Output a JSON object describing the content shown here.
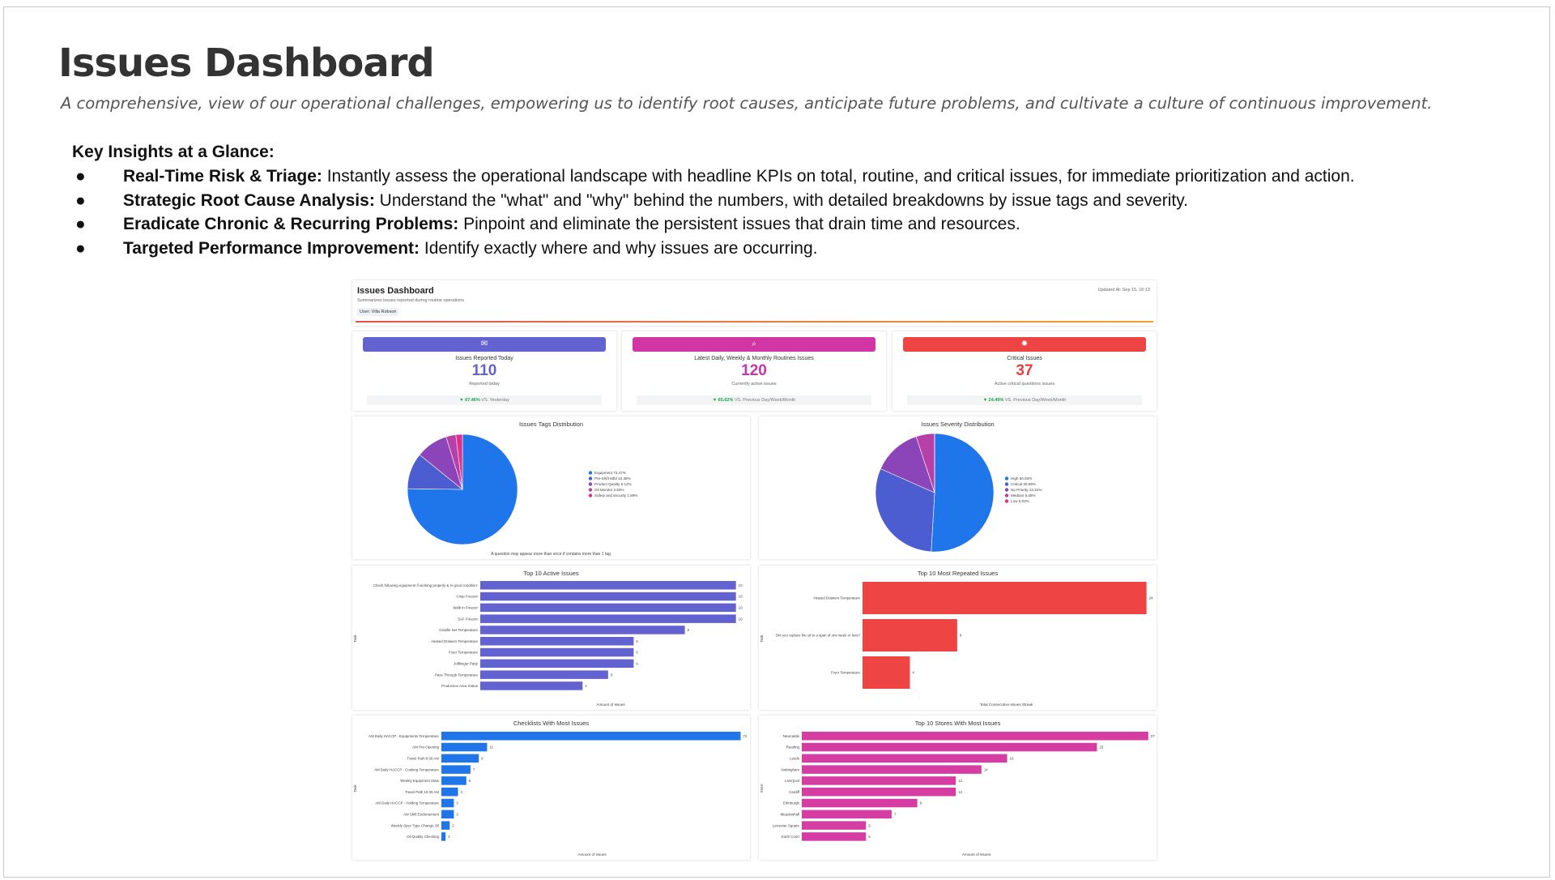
{
  "page": {
    "title": "Issues Dashboard",
    "subtitle": "A comprehensive, view of our operational challenges, empowering us to identify root causes, anticipate future problems, and cultivate a culture of continuous improvement.",
    "insights_heading": "Key Insights at a Glance:",
    "bullet_glyph": "●",
    "bullets": [
      {
        "label": "Real-Time Risk & Triage:",
        "text": "Instantly assess the operational landscape with headline KPIs on total, routine, and critical issues, for immediate prioritization and action."
      },
      {
        "label": "Strategic Root Cause Analysis:",
        "text": "Understand the \"what\" and \"why\" behind the numbers, with detailed breakdowns by issue tags and severity."
      },
      {
        "label": "Eradicate Chronic & Recurring Problems:",
        "text": "Pinpoint and eliminate the persistent issues that drain time and resources."
      },
      {
        "label": "Targeted Performance Improvement:",
        "text": "Identify exactly where and why issues are occurring."
      }
    ]
  },
  "dashboard": {
    "header": {
      "title": "Issues Dashboard",
      "subtitle": "Summarizes issues reported during routine operations",
      "user": "User: Villa Robson",
      "updated": "Updated At: Sep 15, 10:13"
    },
    "kpis": [
      {
        "icon": "chat-bubble-icon",
        "icon_glyph": "✉",
        "label": "Issues Reported Today",
        "value": "110",
        "caption": "Reported today",
        "change": "▼ 67.46%",
        "comparison": "VS. Yesterday",
        "color": "#6362d1",
        "bar_color": "#6362d1"
      },
      {
        "icon": "checklist-search-icon",
        "icon_glyph": "⌕",
        "label": "Latest Daily, Weekly & Monthly Routines Issues",
        "value": "120",
        "caption": "Currently active issues",
        "change": "▼ 65.62%",
        "comparison": "VS. Previous Day/Week/Month",
        "color": "#c536a8",
        "bar_color": "#d235a4"
      },
      {
        "icon": "virus-icon",
        "icon_glyph": "✹",
        "label": "Critical Issues",
        "value": "37",
        "caption": "Active critical questions issues",
        "change": "▼ 24.49%",
        "comparison": "VS. Previous Day/Week/Month",
        "color": "#ec3d3d",
        "bar_color": "#ef4444"
      }
    ]
  },
  "chart_data": [
    {
      "type": "pie",
      "title": "Issues Tags Distribution",
      "footnote": "A question may appear more than once if contains more than 1 tag",
      "slices": [
        {
          "label": "Equipment",
          "value": 73.47,
          "legend": "Equipment 73.47%",
          "color": "#1f75ea"
        },
        {
          "label": "Pre-Shift Mtbl",
          "value": 10.38,
          "legend": "Pre-Shift Mtbl 10.38%",
          "color": "#4c5dd1"
        },
        {
          "label": "Product Quality",
          "value": 9.12,
          "legend": "Product Quality 9.12%",
          "color": "#8c45b8"
        },
        {
          "label": "Oil Monitor",
          "value": 2.83,
          "legend": "Oil Monitor 2.83%",
          "color": "#b63fa8"
        },
        {
          "label": "Safety and security",
          "value": 1.89,
          "legend": "Safety and security 1.89%",
          "color": "#e02e8c"
        }
      ]
    },
    {
      "type": "pie",
      "title": "Issues Severity Distribution",
      "slices": [
        {
          "label": "High",
          "value": 50.93,
          "legend": "High 50.93%",
          "color": "#1f75ea"
        },
        {
          "label": "Critical",
          "value": 30.69,
          "legend": "Critical 30.69%",
          "color": "#4c5dd1"
        },
        {
          "label": "No Priority",
          "value": 13.31,
          "legend": "No Priority 13.31%",
          "color": "#8c45b8"
        },
        {
          "label": "Medium",
          "value": 5.05,
          "legend": "Medium 5.05%",
          "color": "#b63fa8"
        },
        {
          "label": "Low",
          "value": 0.02,
          "legend": "Low 0.02%",
          "color": "#e02e8c"
        }
      ]
    },
    {
      "type": "bar",
      "orientation": "horizontal",
      "title": "Top 10 Active Issues",
      "xlabel": "Amount of issues",
      "ylabel": "Task",
      "color": "#6362d1",
      "categories": [
        "Check following equipment if working properly & in good condition:",
        "Crisp Freezer",
        "Walk in Freezer",
        "SAF Freezer",
        "Griddle Set Temperature",
        "Heated Drawers Temperature",
        "Fryer Temperature",
        "Jollibeger Patty",
        "Pass Through Temperature",
        "Production Area Status"
      ],
      "values": [
        10,
        10,
        10,
        10,
        8,
        6,
        6,
        6,
        5,
        4
      ],
      "xlim": [
        0,
        10.2
      ]
    },
    {
      "type": "bar",
      "orientation": "horizontal",
      "title": "Top 10 Most Repeated Issues",
      "xlabel": "Total Consecutive Issues Streak",
      "ylabel": "Task",
      "color": "#ef4444",
      "categories": [
        "Heated Drawers Temperature",
        "Did you replace the oil in a span of one week or less?",
        "Fryer Temperature"
      ],
      "values": [
        24,
        8,
        4
      ],
      "xlim": [
        0,
        24.3
      ]
    },
    {
      "type": "bar",
      "orientation": "horizontal",
      "title": "Checklists With Most Issues",
      "xlabel": "Amount of issues",
      "ylabel": "Task",
      "color": "#1f75ea",
      "categories": [
        "AM Daily HACCP - Equipments Temperature",
        "AM Pre-Opening",
        "Travel Path 8:30 AM",
        "AM Daily HACCP - Cooking Temperature",
        "Weekly Equipment Stats",
        "Travel Path 10:30 AM",
        "AM Daily HACCP - Holding Temperature",
        "AM Shift Endorsement",
        "Weekly Spec Type Change Oil",
        "Oil Quality Checking"
      ],
      "values": [
        72,
        11,
        9,
        7,
        6,
        4,
        3,
        3,
        2,
        1
      ],
      "xlim": [
        0,
        72.5
      ]
    },
    {
      "type": "bar",
      "orientation": "horizontal",
      "title": "Top 10 Stores With Most Issues",
      "xlabel": "Amount of issues",
      "ylabel": "Store",
      "color": "#d63da3",
      "categories": [
        "Newcastle",
        "Reading",
        "Leeds",
        "Nottingham",
        "Liverpool",
        "Cardiff",
        "Edinburgh",
        "Meadowhall",
        "Leicester Square",
        "Earls Court"
      ],
      "values": [
        27,
        23,
        16,
        14,
        12,
        12,
        9,
        7,
        5,
        5
      ],
      "xlim": [
        0,
        27.2
      ]
    }
  ]
}
